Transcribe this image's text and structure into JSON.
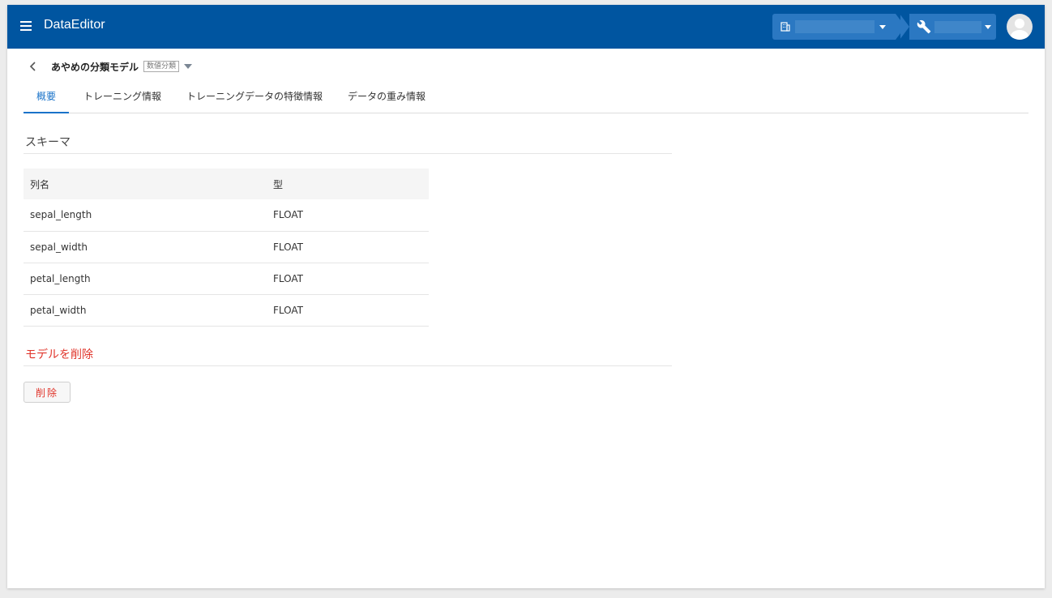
{
  "app": {
    "title": "DataEditor"
  },
  "header": {
    "org_value": "",
    "tool_value": ""
  },
  "breadcrumb": {
    "model_name": "あやめの分類モデル",
    "model_type": "数値分類"
  },
  "tabs": [
    {
      "label": "概要",
      "active": true
    },
    {
      "label": "トレーニング情報",
      "active": false
    },
    {
      "label": "トレーニングデータの特徴情報",
      "active": false
    },
    {
      "label": "データの重み情報",
      "active": false
    }
  ],
  "schema": {
    "title": "スキーマ",
    "columns": [
      "列名",
      "型"
    ],
    "rows": [
      [
        "sepal_length",
        "FLOAT"
      ],
      [
        "sepal_width",
        "FLOAT"
      ],
      [
        "petal_length",
        "FLOAT"
      ],
      [
        "petal_width",
        "FLOAT"
      ]
    ]
  },
  "delete": {
    "title": "モデルを削除",
    "button_label": "削除"
  },
  "colors": {
    "appbar": "#0055a0",
    "accent": "#1a73c9",
    "danger": "#e0342a"
  }
}
